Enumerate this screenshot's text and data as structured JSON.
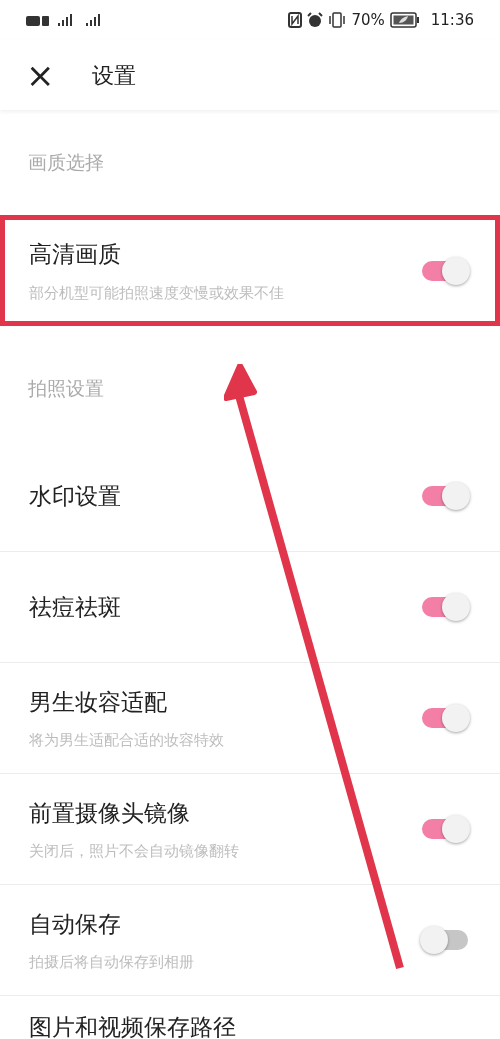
{
  "status_bar": {
    "battery": "70%",
    "time": "11:36"
  },
  "header": {
    "close": "×",
    "title": "设置"
  },
  "sections": [
    {
      "title": "画质选择",
      "items": [
        {
          "title": "高清画质",
          "subtitle": "部分机型可能拍照速度变慢或效果不佳",
          "on": true,
          "highlighted": true
        }
      ]
    },
    {
      "title": "拍照设置",
      "items": [
        {
          "title": "水印设置",
          "on": true,
          "highlighted": false
        },
        {
          "title": "祛痘祛斑",
          "on": true,
          "highlighted": false
        },
        {
          "title": "男生妆容适配",
          "subtitle": "将为男生适配合适的妆容特效",
          "on": true,
          "highlighted": false
        },
        {
          "title": "前置摄像头镜像",
          "subtitle": "关闭后，照片不会自动镜像翻转",
          "on": true,
          "highlighted": false
        },
        {
          "title": "自动保存",
          "subtitle": "拍摄后将自动保存到相册",
          "on": false,
          "highlighted": false
        },
        {
          "title": "图片和视频保存路径",
          "highlighted": false
        }
      ]
    }
  ]
}
